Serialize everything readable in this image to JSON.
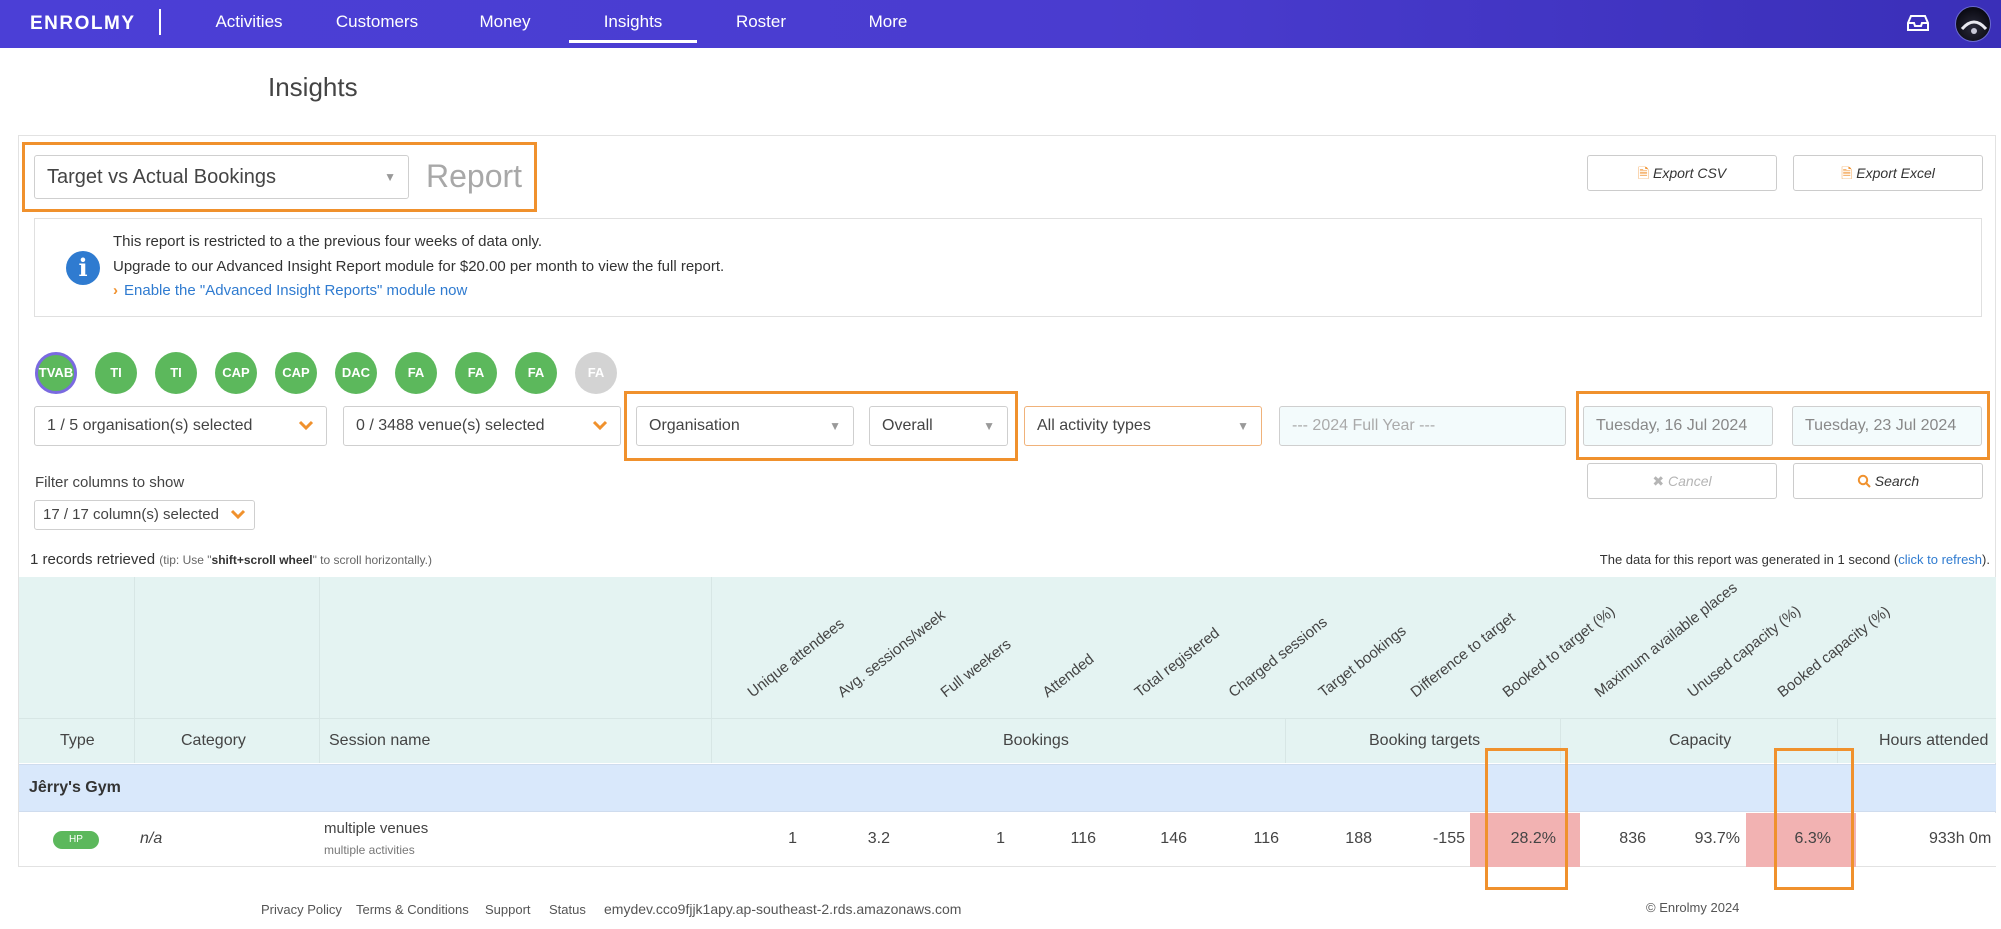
{
  "nav": {
    "logo": "ENROLMY",
    "items": [
      "Activities",
      "Customers",
      "Money",
      "Insights",
      "Roster",
      "More"
    ],
    "active": "Insights"
  },
  "page": {
    "title": "Insights"
  },
  "report": {
    "selected": "Target vs Actual Bookings",
    "report_word": "Report",
    "export_csv": "Export CSV",
    "export_excel": "Export Excel"
  },
  "info": {
    "line1": "This report is restricted to a the previous four weeks of data only.",
    "line2": "Upgrade to our Advanced Insight Report module for $20.00 per month to view the full report.",
    "link": "Enable the \"Advanced Insight Reports\" module now"
  },
  "pills": [
    {
      "label": "TVAB",
      "state": "active"
    },
    {
      "label": "TI",
      "state": "normal"
    },
    {
      "label": "TI",
      "state": "normal"
    },
    {
      "label": "CAP",
      "state": "normal"
    },
    {
      "label": "CAP",
      "state": "normal"
    },
    {
      "label": "DAC",
      "state": "normal"
    },
    {
      "label": "FA",
      "state": "normal"
    },
    {
      "label": "FA",
      "state": "normal"
    },
    {
      "label": "FA",
      "state": "normal"
    },
    {
      "label": "FA",
      "state": "disabled"
    }
  ],
  "filters": {
    "organisations": "1 / 5 organisation(s) selected",
    "venues": "0 / 3488 venue(s) selected",
    "group_by": "Organisation",
    "period": "Overall",
    "activity_types": "All activity types",
    "year_placeholder": "--- 2024 Full Year ---",
    "date_from": "Tuesday, 16 Jul 2024",
    "date_to": "Tuesday, 23 Jul 2024",
    "cancel": "Cancel",
    "search": "Search",
    "columns_label": "Filter columns to show",
    "columns": "17 / 17 column(s) selected"
  },
  "results": {
    "records": "1 records retrieved",
    "tip_pre": "(tip: Use \"",
    "tip_key": "shift+scroll wheel",
    "tip_post": "\" to scroll horizontally.)",
    "generated_pre": "The data for this report was generated in 1 second (",
    "generated_link": "click to refresh",
    "generated_post": ")."
  },
  "table": {
    "rotated_headers": [
      "Unique attendees",
      "Avg. sessions/week",
      "Full weekers",
      "Attended",
      "Total registered",
      "Charged sessions",
      "Target bookings",
      "Difference to target",
      "Booked to target (%)",
      "Maximum available places",
      "Unused capacity (%)",
      "Booked capacity (%)"
    ],
    "headers": {
      "type": "Type",
      "category": "Category",
      "session": "Session name",
      "bookings": "Bookings",
      "targets": "Booking targets",
      "capacity": "Capacity",
      "hours": "Hours attended"
    },
    "group": "Jêrry's Gym",
    "row": {
      "type_badge": "HP",
      "category": "n/a",
      "session_name": "multiple venues",
      "session_sub": "multiple activities",
      "values": [
        "1",
        "3.2",
        "1",
        "116",
        "146",
        "116",
        "188",
        "-155",
        "28.2%",
        "836",
        "93.7%",
        "6.3%"
      ],
      "hours": "933h 0m"
    },
    "highlight_color": "#f2b2b2"
  },
  "footer": {
    "links": [
      "Privacy Policy",
      "Terms & Conditions",
      "Support",
      "Status"
    ],
    "host": "emydev.cco9fjjk1apy.ap-southeast-2.rds.amazonaws.com",
    "copyright": "© Enrolmy 2024"
  },
  "colors": {
    "nav_bg": "#4b3fd6",
    "accent": "#f0912d",
    "success": "#5cb85c",
    "link": "#2f7bd0",
    "table_header_bg": "#e4f3f2",
    "group_bg": "#d9e8fb"
  }
}
